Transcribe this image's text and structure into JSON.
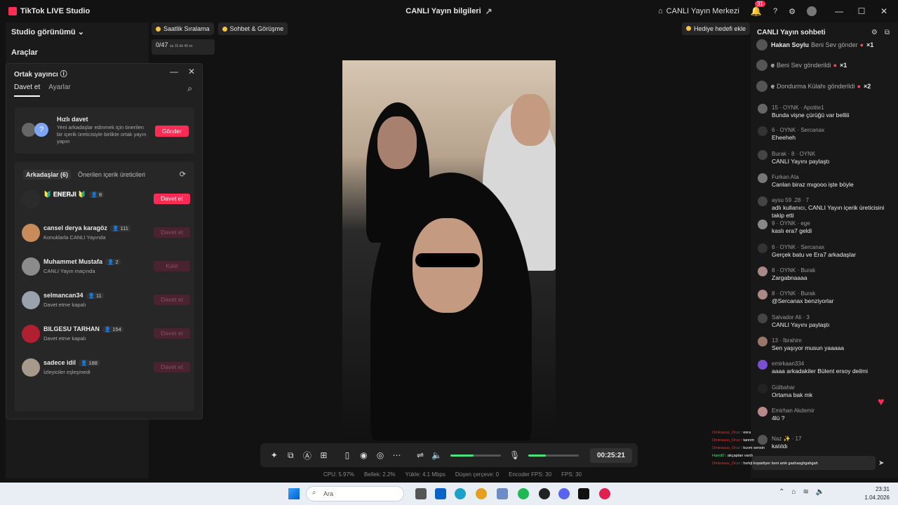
{
  "titlebar": {
    "app_name": "TikTok LIVE Studio",
    "center_title": "CANLI Yayın bilgileri",
    "live_center": "CANLI Yayın Merkezi",
    "notifications": "31"
  },
  "left": {
    "studio_view": "Studio görünümü",
    "tools": "Araçlar"
  },
  "top_pills": [
    "Saatlik Sıralama",
    "Sohbet & Görüşme"
  ],
  "mini_card": {
    "value": "0/47",
    "sub": "sa 15 dk 40 sn"
  },
  "goal_button": "Hediye hedefi ekle",
  "popup": {
    "title": "Ortak yayıncı",
    "tabs": [
      "Davet et",
      "Ayarlar"
    ],
    "quick": {
      "title": "Hızlı davet",
      "desc": "Yeni arkadaşlar edinmek için önerilen bir içerik üreticisiyle birlikte ortak yayın yapın",
      "button": "Gönder"
    },
    "friend_tabs": [
      "Arkadaşlar (6)",
      "Önerilen içerik üreticileri"
    ],
    "friends": [
      {
        "name": "🔰 𝐄𝐍𝐄𝐑𝐉𝐈 🔰",
        "count": "8",
        "status": "",
        "button": "Davet et",
        "active": true,
        "color": "#2b2b2b"
      },
      {
        "name": "cansel derya karagöz",
        "count": "111",
        "status": "Konuklarla CANLI Yayında",
        "button": "Davet et",
        "active": false,
        "color": "#c98b5a"
      },
      {
        "name": "Muhammet Mustafa",
        "count": "2",
        "status": "CANLI Yayın maçında",
        "button": "Katıl",
        "active": false,
        "color": "#8b8b8b"
      },
      {
        "name": "selmancan34",
        "count": "11",
        "status": "Davet etme kapalı",
        "button": "Davet et",
        "active": false,
        "color": "#9aa3ad"
      },
      {
        "name": "BILGESU TARHAN",
        "count": "154",
        "status": "Davet etme kapalı",
        "button": "Davet et",
        "active": false,
        "color": "#b02030"
      },
      {
        "name": "sadece idil",
        "count": "188",
        "status": "İzleyiciler eşleşmedi",
        "button": "Davet et",
        "active": false,
        "color": "#a89a8a"
      }
    ]
  },
  "controls": {
    "icons": [
      "magic-icon",
      "screen-share-icon",
      "ai-icon",
      "add-source-icon",
      "phone-icon",
      "record-icon",
      "camera-icon",
      "more-icon",
      "mixer-icon",
      "speaker-icon",
      "mic-icon"
    ],
    "speaker_level": 0.45,
    "mic_level": 0.35,
    "timer": "00:25:21"
  },
  "stats": [
    "CPU: 5.97%",
    "Bellek: 2.2%",
    "Yükle: 4.1 Mbps",
    "Düşen çerçeve: 0",
    "Encoder FPS: 30",
    "FPS: 30"
  ],
  "chat": {
    "title": "CANLI Yayın sohbeti",
    "gifts": [
      {
        "name": "Hakan Soylu",
        "text": "Beni Sev gönder",
        "mult": "×1"
      },
      {
        "name": "e",
        "text": "Beni Sev gönderildi",
        "mult": "×1"
      },
      {
        "name": "e",
        "text": "Dondurma Külahı gönderildi",
        "mult": "×2"
      }
    ],
    "messages": [
      {
        "meta": "15 · OYNK · Apotite1",
        "text": "Bunda vişne çürüğü var belliii",
        "color": "#666"
      },
      {
        "meta": "6 · OYNK · Sercanax",
        "text": "Eheeheh",
        "color": "#333"
      },
      {
        "meta": "Burak · 8 · OYNK",
        "text": "CANLI Yayını paylaştı",
        "color": "#444"
      },
      {
        "meta": "Furkan Ata",
        "text": "Canlan biraz mıgooo işte böyle",
        "color": "#777"
      },
      {
        "meta": "aysu 59 .28 · 7",
        "text": "adlı kullanıcı, CANLI Yayın içerik üreticisini takip etti",
        "color": "#444"
      },
      {
        "meta": "9 · OYNK · ege",
        "text": "kaslı era7 geldi",
        "color": "#888"
      },
      {
        "meta": "6 · OYNK · Sercanax",
        "text": "Gerçek batu ve Era7 arkadaşlar",
        "color": "#333"
      },
      {
        "meta": "8 · OYNK · Burak",
        "text": "Zargabnaaaa",
        "color": "#a88"
      },
      {
        "meta": "8 · OYNK · Burak",
        "text": "@Sercanax benziyorlar",
        "color": "#a88"
      },
      {
        "meta": "Salvador Ali · 3",
        "text": "CANLI Yayını paylaştı",
        "color": "#444"
      },
      {
        "meta": "13 · İbrahim",
        "text": "Sen yaşıyor musun yaaaaa",
        "color": "#976"
      },
      {
        "meta": "emirkaan334",
        "text": "aaaa arkadakiler Bülent ersoy deilmi",
        "color": "#7a4fd0"
      },
      {
        "meta": "Gülbahar",
        "text": "Ortama bak mk",
        "color": "#222"
      },
      {
        "meta": "Emirhan Akdemir",
        "text": "4lü ?",
        "color": "#b88"
      },
      {
        "meta": "Naz ✨ · 17",
        "text": "katıldı",
        "color": "#555"
      }
    ]
  },
  "overlay_lines": [
    {
      "user": "Ominasus_Oruz",
      "text": ": esra"
    },
    {
      "user": "Ominasus_Oruz",
      "text": ": tanrım"
    },
    {
      "user": "Ominasus_Oruz",
      "text": ": kızım sensin"
    },
    {
      "user": "Hamit0",
      "text": ": akçaptan vardı"
    },
    {
      "user": "Ominasus_Oruz",
      "text": ": hsrkjt kopartiyer beni amk gashasghgahgah"
    }
  ],
  "taskbar": {
    "search_placeholder": "Ara",
    "time": "23:31",
    "date": "1.04.2026"
  }
}
